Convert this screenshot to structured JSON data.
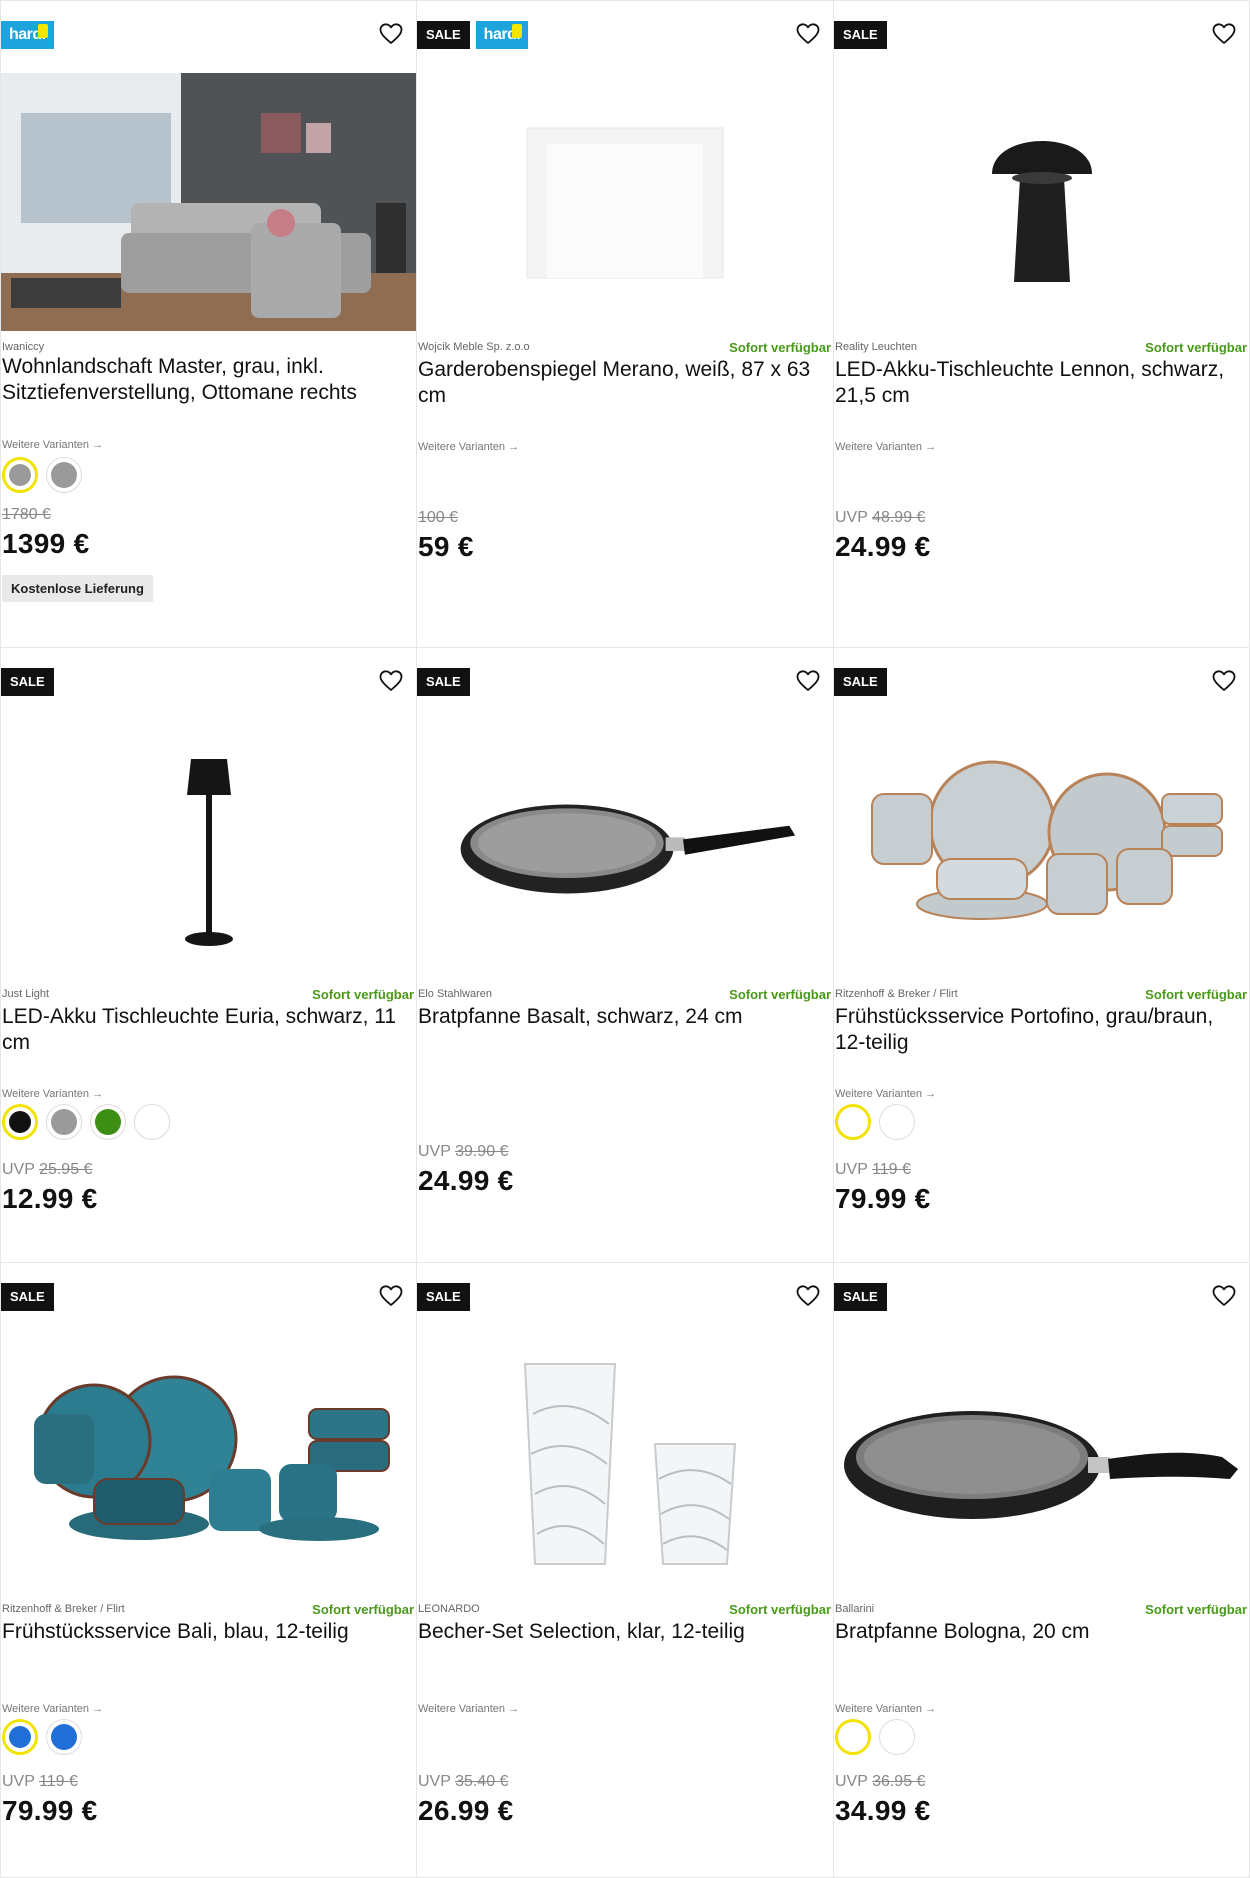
{
  "wishlist_icon": "heart-outline-icon",
  "colors": {
    "sale_bg": "#111111",
    "hardi_bg": "#1ea4dd",
    "hardi_accent": "#f3e500",
    "available": "#4a9a1a",
    "selected_ring": "#f2e400"
  },
  "products": [
    {
      "badges": [
        "hardi"
      ],
      "hardi_label": "hardi",
      "brand": "Iwaniccy",
      "availability": "",
      "title": "Wohnlandschaft Master, grau, inkl. Sitztiefenverstellung, Ottomane rechts",
      "variants_label": "Weitere Varianten →",
      "swatches": [
        "#9a9a9a",
        "#9a9a9a"
      ],
      "selected_swatch": 0,
      "uvp_label": "",
      "old_price": "1780 €",
      "price": "1399 €",
      "extra_tag": "Kostenlose Lieferung",
      "image": "grey-sectional-sofa-living-room"
    },
    {
      "badges": [
        "SALE",
        "hardi"
      ],
      "hardi_label": "hardi",
      "brand": "Wojcik Meble Sp. z.o.o",
      "availability": "Sofort verfügbar",
      "title": "Garderobenspiegel Merano, weiß, 87 x 63 cm",
      "variants_label": "Weitere Varianten →",
      "swatches": [],
      "uvp_label": "",
      "old_price": "100 €",
      "price": "59 €",
      "image": "white-wall-mirror"
    },
    {
      "badges": [
        "SALE"
      ],
      "brand": "Reality Leuchten",
      "availability": "Sofort verfügbar",
      "title": "LED-Akku-Tischleuchte Lennon, schwarz, 21,5 cm",
      "variants_label": "Weitere Varianten →",
      "swatches": [],
      "uvp_label": "UVP",
      "old_price": "48.99 €",
      "price": "24.99 €",
      "image": "black-mushroom-lamp"
    },
    {
      "badges": [
        "SALE"
      ],
      "brand": "Just Light",
      "availability": "Sofort verfügbar",
      "title": "LED-Akku Tischleuchte Euria, schwarz, 11 cm",
      "variants_label": "Weitere Varianten →",
      "swatches": [
        "#111111",
        "#9a9a9a",
        "#3c8f12",
        "#ffffff"
      ],
      "selected_swatch": 0,
      "uvp_label": "UVP",
      "old_price": "25.95 €",
      "price": "12.99 €",
      "image": "black-slim-table-lamp"
    },
    {
      "badges": [
        "SALE"
      ],
      "brand": "Elo Stahlwaren",
      "availability": "Sofort verfügbar",
      "title": "Bratpfanne Basalt, schwarz, 24 cm",
      "variants_label": "",
      "swatches": [],
      "uvp_label": "UVP",
      "old_price": "39.90 €",
      "price": "24.99 €",
      "image": "black-frying-pan"
    },
    {
      "badges": [
        "SALE"
      ],
      "brand": "Ritzenhoff & Breker / Flirt",
      "availability": "Sofort verfügbar",
      "title": "Frühstücksservice Portofino, grau/braun, 12-teilig",
      "variants_label": "Weitere Varianten →",
      "swatches": [
        "#ffffff",
        "#ffffff"
      ],
      "selected_swatch": 0,
      "uvp_label": "UVP",
      "old_price": "119 €",
      "price": "79.99 €",
      "image": "grey-brown-dinnerware-set"
    },
    {
      "badges": [
        "SALE"
      ],
      "brand": "Ritzenhoff & Breker / Flirt",
      "availability": "Sofort verfügbar",
      "title": "Frühstücksservice Bali, blau, 12-teilig",
      "variants_label": "Weitere Varianten →",
      "swatches": [
        "#1f6fd6",
        "#1f6fd6"
      ],
      "selected_swatch": 0,
      "uvp_label": "UVP",
      "old_price": "119 €",
      "price": "79.99 €",
      "image": "blue-dinnerware-set"
    },
    {
      "badges": [
        "SALE"
      ],
      "brand": "LEONARDO",
      "availability": "Sofort verfügbar",
      "title": "Becher-Set Selection, klar, 12-teilig",
      "variants_label": "Weitere Varianten →",
      "swatches": [],
      "uvp_label": "UVP",
      "old_price": "35.40 €",
      "price": "26.99 €",
      "image": "clear-glass-tumblers"
    },
    {
      "badges": [
        "SALE"
      ],
      "brand": "Ballarini",
      "availability": "Sofort verfügbar",
      "title": "Bratpfanne Bologna, 20 cm",
      "variants_label": "Weitere Varianten →",
      "swatches": [
        "#ffffff",
        "#ffffff"
      ],
      "selected_swatch": 0,
      "uvp_label": "UVP",
      "old_price": "36.95 €",
      "price": "34.99 €",
      "image": "granite-frying-pan"
    }
  ]
}
